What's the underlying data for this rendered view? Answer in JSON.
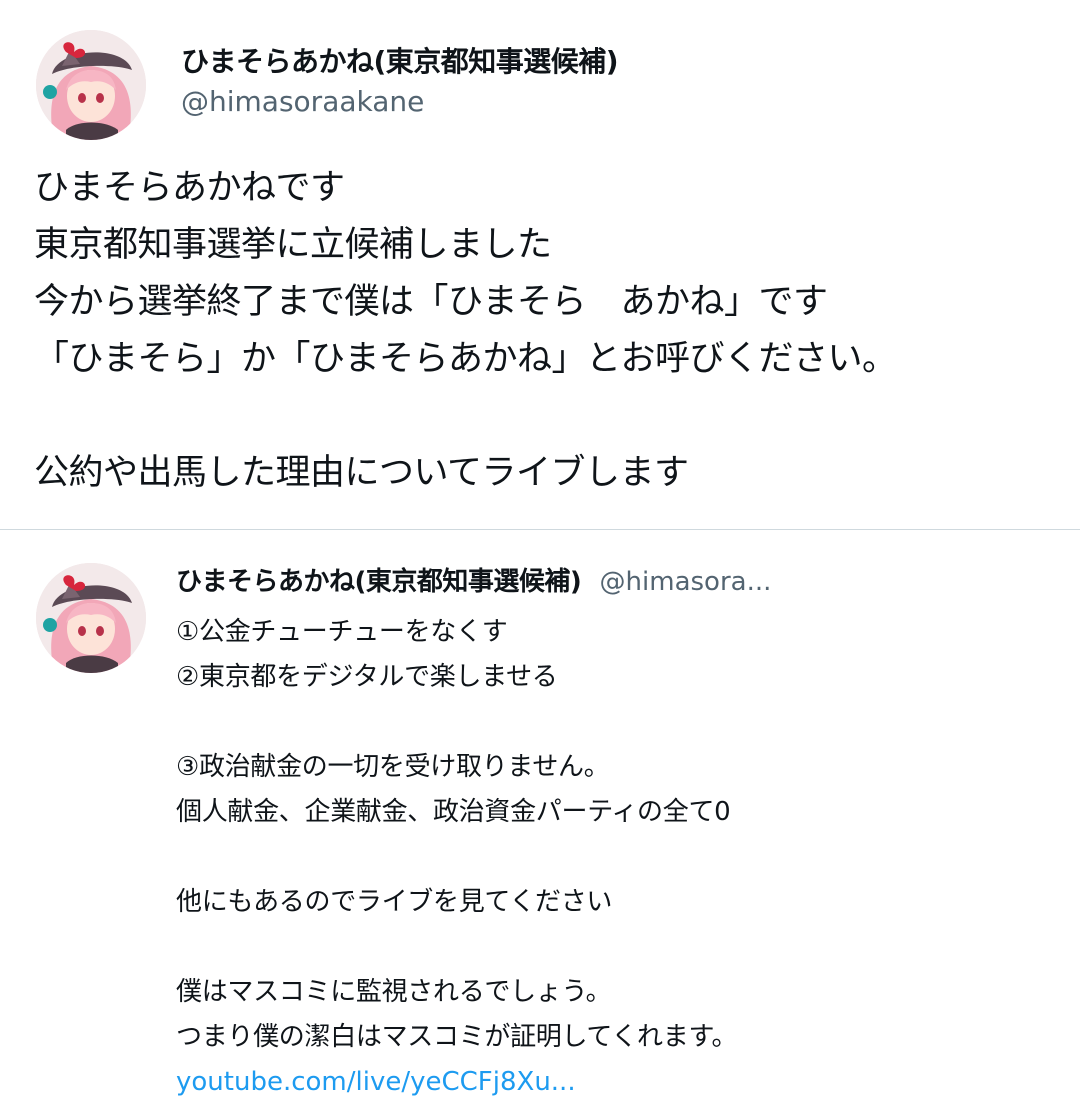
{
  "main_tweet": {
    "display_name": "ひまそらあかね(東京都知事選候補)",
    "handle": "@himasoraakane",
    "text": "ひまそらあかねです\n東京都知事選挙に立候補しました\n今から選挙終了まで僕は「ひまそら　あかね」です\n「ひまそら」か「ひまそらあかね」とお呼びください。\n\n公約や出馬した理由についてライブします"
  },
  "reply_tweet": {
    "display_name": "ひまそらあかね(東京都知事選候補)",
    "handle": "@himasora...",
    "text": "①公金チューチューをなくす\n②東京都をデジタルで楽しませる\n\n③政治献金の一切を受け取りません。\n個人献金、企業献金、政治資金パーティの全て0\n\n他にもあるのでライブを見てください\n\n僕はマスコミに監視されるでしょう。\nつまり僕の潔白はマスコミが証明してくれます。",
    "link": "youtube.com/live/yeCCFj8Xu..."
  },
  "colors": {
    "text": "#0f1419",
    "secondary_text": "#536471",
    "link": "#1d9bf0",
    "divider": "#cfd9de"
  }
}
